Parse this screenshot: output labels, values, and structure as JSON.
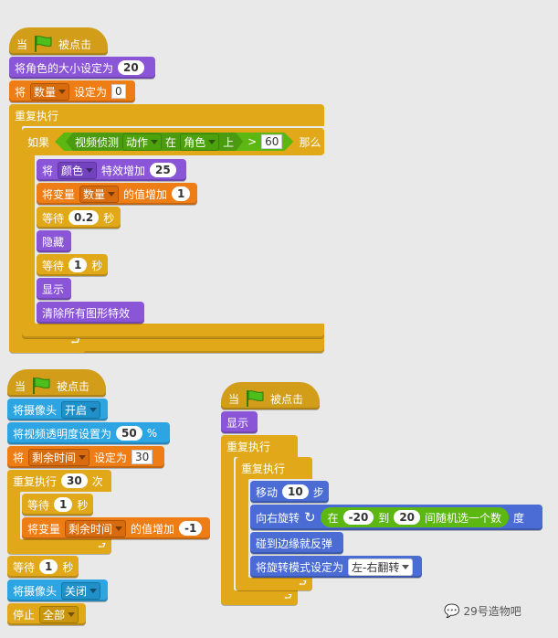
{
  "common": {
    "when": "当",
    "clicked": "被点击",
    "forever": "重复执行",
    "show": "显示"
  },
  "script1": {
    "set_size": "将角色的大小设定为",
    "size_value": "20",
    "set_label": "将",
    "set_var": "数量",
    "set_to": "设定为",
    "set_value": "0",
    "if_label": "如果",
    "video_sense": "视频侦测",
    "sense_attr": "动作",
    "sense_on": "在",
    "sense_target": "角色",
    "sense_suffix": "上",
    "gt": ">",
    "threshold": "60",
    "then": "那么",
    "change_effect_prefix": "将",
    "effect": "颜色",
    "effect_change": "特效增加",
    "effect_value": "25",
    "change_var_label": "将变量",
    "change_var": "数量",
    "change_by": "的值增加",
    "change_value": "1",
    "wait": "等待",
    "wait_value1": "0.2",
    "seconds": "秒",
    "hide": "隐藏",
    "wait_value2": "1",
    "clear_effects": "清除所有图形特效"
  },
  "script2": {
    "camera_label": "将摄像头",
    "camera_on": "开启",
    "transparency": "将视频透明度设置为",
    "transparency_value": "50",
    "percent": "%",
    "set_label": "将",
    "var": "剩余时间",
    "set_to": "设定为",
    "var_value": "30",
    "repeat": "重复执行",
    "repeat_value": "30",
    "times": "次",
    "wait": "等待",
    "wait_value": "1",
    "seconds": "秒",
    "change_var_label": "将变量",
    "change_by": "的值增加",
    "change_value": "-1",
    "wait_value2": "1",
    "camera_off": "关闭",
    "stop": "停止",
    "stop_option": "全部"
  },
  "script3": {
    "move": "移动",
    "move_value": "10",
    "steps": "步",
    "turn": "向右旋转",
    "turn_in": "在",
    "rand_from": "-20",
    "rand_to_label": "到",
    "rand_to": "20",
    "rand_suffix": "间随机选一个数",
    "degrees": "度",
    "bounce": "碰到边缘就反弹",
    "rotation_style": "将旋转模式设定为",
    "rotation_option": "左-右翻转"
  },
  "watermark": "29号造物吧"
}
